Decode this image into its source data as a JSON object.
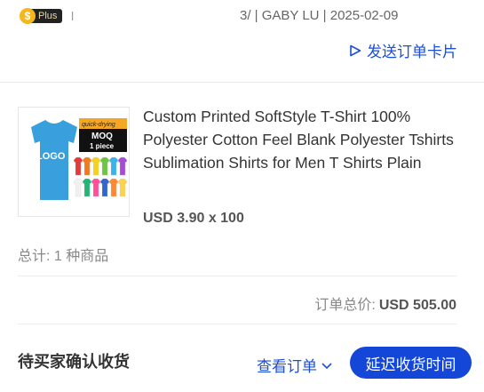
{
  "header": {
    "plus_badge_icon": "dollar-coin-icon",
    "plus_badge_label": "Plus",
    "truncated_char": "l",
    "meta_text": "3/ | GABY LU | 2025-02-09",
    "send_card_label": "发送订单卡片",
    "send_card_icon": "send-triangle-icon"
  },
  "product": {
    "image": {
      "tag_top": "quick-drying",
      "tag_moq": "MOQ",
      "tag_piece": "1 piece",
      "logo_text": "LOGO",
      "shirt_color": "#3aa0dd",
      "swatches": [
        "#e23b3b",
        "#f07a1c",
        "#f5d21e",
        "#6cc644",
        "#3bb3e6",
        "#a64bd6",
        "#f1f1f1",
        "#22b573",
        "#ff4f9a",
        "#3366cc",
        "#ff8833",
        "#ffd24d"
      ]
    },
    "title": "Custom Printed SoftStyle T-Shirt 100% Polyester Cotton Feel Blank Polyester Tshirts Sublimation Shirts for Men T Shirts Plain",
    "price_line": "USD 3.90 x 100"
  },
  "summary": {
    "total_items": "总计: 1 种商品",
    "order_total_label": "订单总价:",
    "order_total_value": "USD 505.00"
  },
  "footer": {
    "status": "待买家确认收货",
    "view_order_label": "查看订单",
    "view_order_icon": "chevron-down-icon",
    "delay_button_label": "延迟收货时间"
  },
  "colors": {
    "accent": "#1446d8",
    "link": "#1a4fd6",
    "badge_coin": "#f5b81c"
  }
}
